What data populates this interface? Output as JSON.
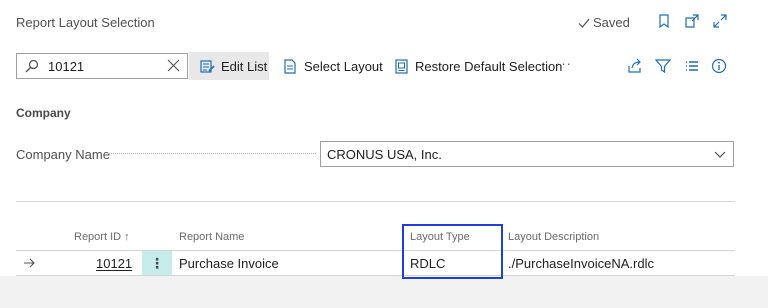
{
  "header": {
    "title": "Report Layout Selection",
    "saved_label": "Saved"
  },
  "toolbar": {
    "search_value": "10121",
    "edit_list_label": "Edit List",
    "select_layout_label": "Select Layout",
    "restore_default_label": "Restore Default Selection",
    "more_label": "···"
  },
  "company": {
    "section_title": "Company",
    "field_label": "Company Name",
    "field_value": "CRONUS USA, Inc."
  },
  "table": {
    "columns": {
      "report_id": "Report ID",
      "report_id_sort": "↑",
      "report_name": "Report Name",
      "layout_type": "Layout Type",
      "layout_description": "Layout Description"
    },
    "rows": [
      {
        "report_id": "10121",
        "report_name": "Purchase Invoice",
        "layout_type": "RDLC",
        "layout_description": "./PurchaseInvoiceNA.rdlc"
      }
    ]
  },
  "colors": {
    "accent": "#1a6fb5",
    "selected_cell": "#c7ecec",
    "highlight_box": "#1f3fd6"
  }
}
